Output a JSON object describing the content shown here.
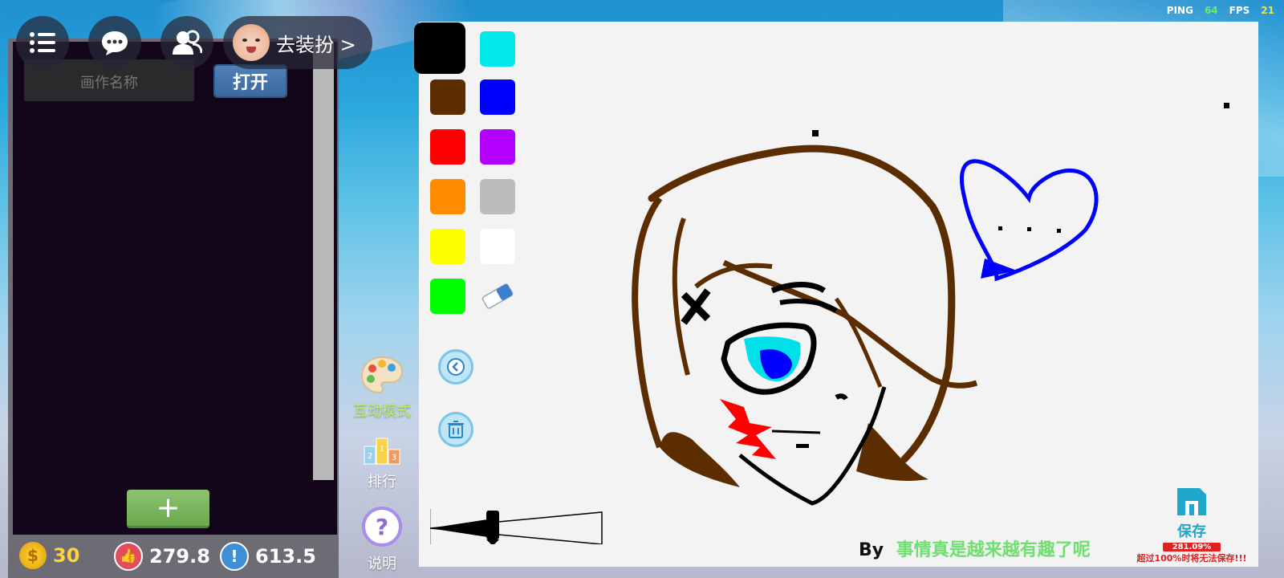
{
  "hud": {
    "ping_label": "PING",
    "ping_value": "64",
    "fps_label": "FPS",
    "fps_value": "21"
  },
  "topbar": {
    "menu_icon": "list-icon",
    "chat_icon": "chat-bubble-icon",
    "friends_icon": "users-icon",
    "dress_up_label": "去装扮 >"
  },
  "left_panel": {
    "name_placeholder": "画作名称",
    "open_label": "打开",
    "add_label": "+"
  },
  "stats": {
    "coins": "30",
    "likes": "279.8",
    "reports": "613.5"
  },
  "side_tools": [
    {
      "label": "互动模式",
      "icon": "palette-icon"
    },
    {
      "label": "排行",
      "icon": "podium-icon"
    },
    {
      "label": "说明",
      "icon": "help-icon"
    }
  ],
  "palette": {
    "colors": [
      "#000000",
      "#00e8e8",
      "#5c2d00",
      "#0000ff",
      "#ff0000",
      "#b400ff",
      "#ff8c00",
      "#bcbcbc",
      "#ffff00",
      "#ffffff",
      "#00ff00"
    ],
    "selected": "#000000",
    "eraser_icon": "eraser-icon",
    "undo_icon": "undo-icon",
    "clear_icon": "trash-icon"
  },
  "canvas": {
    "by_label": "By",
    "author": "事情真是越来越有趣了呢",
    "save_label": "保存",
    "usage_percent": "281.09%",
    "limit_warning": "超过100%时将无法保存!!!"
  }
}
